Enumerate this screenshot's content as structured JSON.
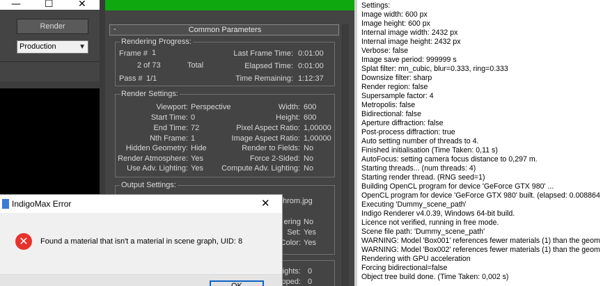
{
  "window_controls": {
    "minimize": "—",
    "maximize": "☐",
    "close": "✕"
  },
  "left": {
    "render_button": "Render",
    "preset_value": "Production"
  },
  "rollout": {
    "toggle": "-",
    "title": "Common Parameters"
  },
  "progress": {
    "title": "Rendering Progress:",
    "frame_label": "Frame #",
    "frame_value": "1",
    "frame_of": "2 of 73",
    "total_label": "Total",
    "pass_label": "Pass #",
    "pass_value": "1/1",
    "last_frame_time_label": "Last Frame Time:",
    "last_frame_time_value": "0:01:00",
    "elapsed_time_label": "Elapsed Time:",
    "elapsed_time_value": "0:01:00",
    "time_remaining_label": "Time Remaining:",
    "time_remaining_value": "1:12:37"
  },
  "settings": {
    "title": "Render Settings:",
    "left_rows": [
      {
        "label": "Viewport:",
        "value": "Perspective"
      },
      {
        "label": "Start Time:",
        "value": "0"
      },
      {
        "label": "End Time:",
        "value": "72"
      },
      {
        "label": "Nth Frame:",
        "value": "1"
      },
      {
        "label": "Hidden Geometry:",
        "value": "Hide"
      },
      {
        "label": "Render Atmosphere:",
        "value": "Yes"
      },
      {
        "label": "Use Adv. Lighting:",
        "value": "Yes"
      }
    ],
    "right_rows": [
      {
        "label": "Width:",
        "value": "600"
      },
      {
        "label": "Height:",
        "value": "600"
      },
      {
        "label": "Pixel Aspect Ratio:",
        "value": "1,00000"
      },
      {
        "label": "Image Aspect Ratio:",
        "value": "1,00000"
      },
      {
        "label": "Render to Fields:",
        "value": "No"
      },
      {
        "label": "Force 2-Sided:",
        "value": "No"
      },
      {
        "label": "Compute Adv. Lighting:",
        "value": "No"
      }
    ]
  },
  "output": {
    "title": "Output Settings:",
    "file_partial": "hrom.jpg",
    "partial_rows": [
      {
        "label": "ering",
        "value": "No"
      },
      {
        "label": "Set:",
        "value": "Yes"
      },
      {
        "label": "Color:",
        "value": "Yes"
      }
    ]
  },
  "lighting_partial": [
    {
      "label": "Lights:",
      "value": "0"
    },
    {
      "label": "apped:",
      "value": "0"
    }
  ],
  "log": [
    "Settings:",
    "Image width: 600 px",
    "Image height: 600 px",
    "Internal image width: 2432 px",
    "Internal image height: 2432 px",
    "Verbose: false",
    "Image save period: 999999 s",
    "Splat filter: mn_cubic, blur=0.333, ring=0.333",
    "Downsize filter: sharp",
    "Render region: false",
    "Supersample factor: 4",
    "Metropolis: false",
    "Bidirectional: false",
    "Aperture diffraction: false",
    "Post-process diffraction: true",
    "Auto setting number of threads to 4.",
    "Finished initialisation (Time Taken: 0,11 s)",
    "AutoFocus: setting camera focus distance to 0,297 m.",
    "Starting threads... (num threads: 4)",
    "Starting render thread. (RNG seed=1)",
    "Building OpenCL program for device 'GeForce GTX 980' ...",
    "OpenCL program for device 'GeForce GTX 980' built. (elapsed: 0.008864",
    "Executing 'Dummy_scene_path'",
    "Indigo Renderer v4.0.39, Windows 64-bit build.",
    "Licence not verified, running in free mode.",
    "Scene file path: 'Dummy_scene_path'",
    "WARNING: Model 'Box001' references fewer materials (1) than the geom",
    "WARNING: Model 'Box002' references fewer materials (1) than the geom",
    "Rendering with GPU acceleration",
    "Forcing bidirectional=false",
    "Object tree build done. (Time Taken: 0,002 s)"
  ],
  "dialog": {
    "title": "IndigoMax Error",
    "close": "✕",
    "error_icon": "✕",
    "message": "Found a material that isn't a material in scene graph, UID: 8",
    "ok_label": "OK"
  }
}
